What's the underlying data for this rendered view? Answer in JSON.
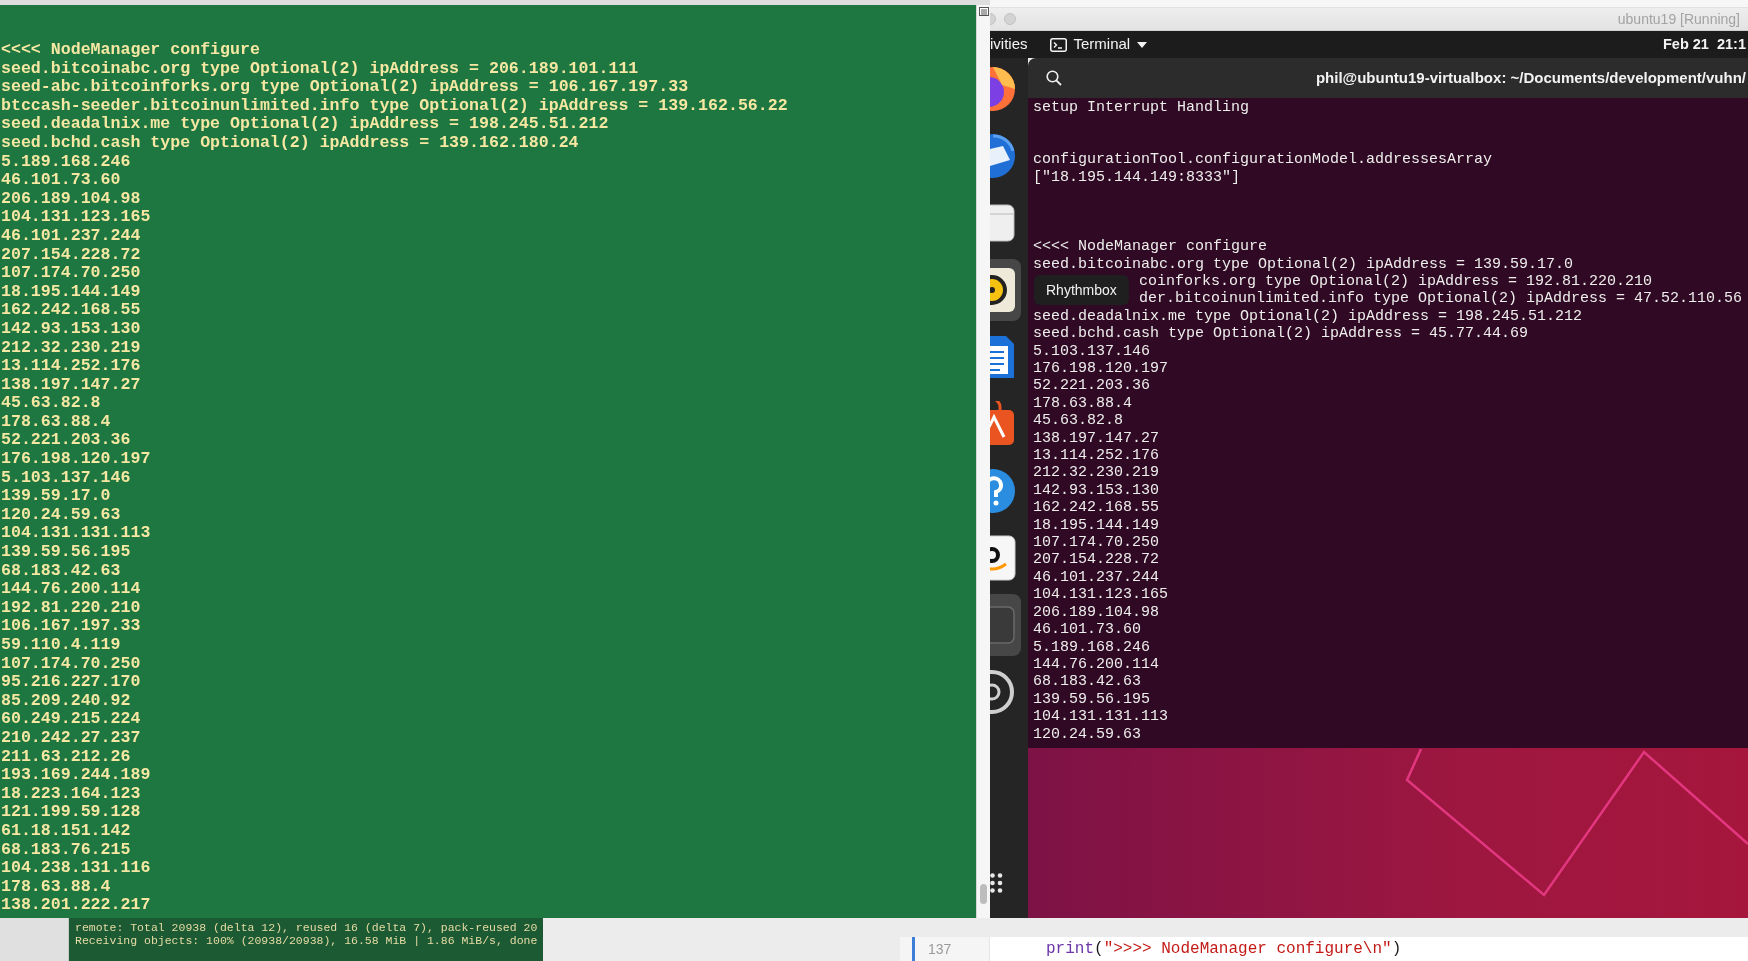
{
  "left_terminal": {
    "lines": [
      "<<<< NodeManager configure",
      "seed.bitcoinabc.org type Optional(2) ipAddress = 206.189.101.111",
      "seed-abc.bitcoinforks.org type Optional(2) ipAddress = 106.167.197.33",
      "btccash-seeder.bitcoinunlimited.info type Optional(2) ipAddress = 139.162.56.22",
      "seed.deadalnix.me type Optional(2) ipAddress = 198.245.51.212",
      "seed.bchd.cash type Optional(2) ipAddress = 139.162.180.24",
      "5.189.168.246",
      "46.101.73.60",
      "206.189.104.98",
      "104.131.123.165",
      "46.101.237.244",
      "207.154.228.72",
      "107.174.70.250",
      "18.195.144.149",
      "162.242.168.55",
      "142.93.153.130",
      "212.32.230.219",
      "13.114.252.176",
      "138.197.147.27",
      "45.63.82.8",
      "178.63.88.4",
      "52.221.203.36",
      "176.198.120.197",
      "5.103.137.146",
      "139.59.17.0",
      "120.24.59.63",
      "104.131.131.113",
      "139.59.56.195",
      "68.183.42.63",
      "144.76.200.114",
      "192.81.220.210",
      "106.167.197.33",
      "59.110.4.119",
      "107.174.70.250",
      "95.216.227.170",
      "85.209.240.92",
      "60.249.215.224",
      "210.242.27.237",
      "211.63.212.26",
      "193.169.244.189",
      "18.223.164.123",
      "121.199.59.128",
      "61.18.151.142",
      "68.183.76.215",
      "104.238.131.116",
      "178.63.88.4",
      "138.201.222.217"
    ]
  },
  "vm_window": {
    "title": "ubuntu19 [Running]",
    "top_bar": {
      "activities": "ivities",
      "app_menu": "Terminal",
      "clock": "Feb 21  21:1"
    },
    "dock": {
      "items": [
        {
          "kind": "globe",
          "highlighted": false
        },
        {
          "kind": "bird",
          "highlighted": false
        },
        {
          "kind": "drawer",
          "highlighted": false
        },
        {
          "kind": "speaker",
          "highlighted": true
        },
        {
          "kind": "document",
          "highlighted": false
        },
        {
          "kind": "store",
          "highlighted": false
        },
        {
          "kind": "help",
          "highlighted": false
        },
        {
          "kind": "tile",
          "highlighted": false
        },
        {
          "kind": "screen",
          "highlighted": true
        },
        {
          "kind": "disc",
          "highlighted": false
        }
      ]
    },
    "tooltip": "Rhythmbox",
    "terminal": {
      "title": "phil@ubuntu19-virtualbox: ~/Documents/development/vuhn/",
      "lines": [
        {
          "kind": "text",
          "text": "setup Interrupt Handling"
        },
        {
          "kind": "blank"
        },
        {
          "kind": "blank"
        },
        {
          "kind": "text",
          "text": "configurationTool.configurationModel.addressesArray"
        },
        {
          "kind": "text",
          "text": "[\"18.195.144.149:8333\"]"
        },
        {
          "kind": "blank"
        },
        {
          "kind": "blank"
        },
        {
          "kind": "blank"
        },
        {
          "kind": "text",
          "text": "<<<< NodeManager configure"
        },
        {
          "kind": "text",
          "text": "seed.bitcoinabc.org type Optional(2) ipAddress = 139.59.17.0"
        },
        {
          "kind": "covered",
          "text": "coinforks.org type Optional(2) ipAddress = 192.81.220.210"
        },
        {
          "kind": "covered",
          "text": "der.bitcoinunlimited.info type Optional(2) ipAddress = 47.52.110.56"
        },
        {
          "kind": "text",
          "text": "seed.deadalnix.me type Optional(2) ipAddress = 198.245.51.212"
        },
        {
          "kind": "text",
          "text": "seed.bchd.cash type Optional(2) ipAddress = 45.77.44.69"
        },
        {
          "kind": "text",
          "text": "5.103.137.146"
        },
        {
          "kind": "text",
          "text": "176.198.120.197"
        },
        {
          "kind": "text",
          "text": "52.221.203.36"
        },
        {
          "kind": "text",
          "text": "178.63.88.4"
        },
        {
          "kind": "text",
          "text": "45.63.82.8"
        },
        {
          "kind": "text",
          "text": "138.197.147.27"
        },
        {
          "kind": "text",
          "text": "13.114.252.176"
        },
        {
          "kind": "text",
          "text": "212.32.230.219"
        },
        {
          "kind": "text",
          "text": "142.93.153.130"
        },
        {
          "kind": "text",
          "text": "162.242.168.55"
        },
        {
          "kind": "text",
          "text": "18.195.144.149"
        },
        {
          "kind": "text",
          "text": "107.174.70.250"
        },
        {
          "kind": "text",
          "text": "207.154.228.72"
        },
        {
          "kind": "text",
          "text": "46.101.237.244"
        },
        {
          "kind": "text",
          "text": "104.131.123.165"
        },
        {
          "kind": "text",
          "text": "206.189.104.98"
        },
        {
          "kind": "text",
          "text": "46.101.73.60"
        },
        {
          "kind": "text",
          "text": "5.189.168.246"
        },
        {
          "kind": "text",
          "text": "144.76.200.114"
        },
        {
          "kind": "text",
          "text": "68.183.42.63"
        },
        {
          "kind": "text",
          "text": "139.59.56.195"
        },
        {
          "kind": "text",
          "text": "104.131.131.113"
        },
        {
          "kind": "text",
          "text": "120.24.59.63"
        }
      ]
    }
  },
  "background_terminal": {
    "lines": [
      "remote: Total 20938 (delta 12), reused 16 (delta 7), pack-reused 20",
      "Receiving objects: 100% (20938/20938), 16.58 MiB | 1.86 MiB/s, done"
    ]
  },
  "code_editor": {
    "line_number": "137",
    "tokens": [
      {
        "kind": "function",
        "text": "print"
      },
      {
        "kind": "plain",
        "text": "("
      },
      {
        "kind": "string",
        "text": "\">>>> NodeManager configure\\n\""
      },
      {
        "kind": "plain",
        "text": ")"
      }
    ]
  }
}
